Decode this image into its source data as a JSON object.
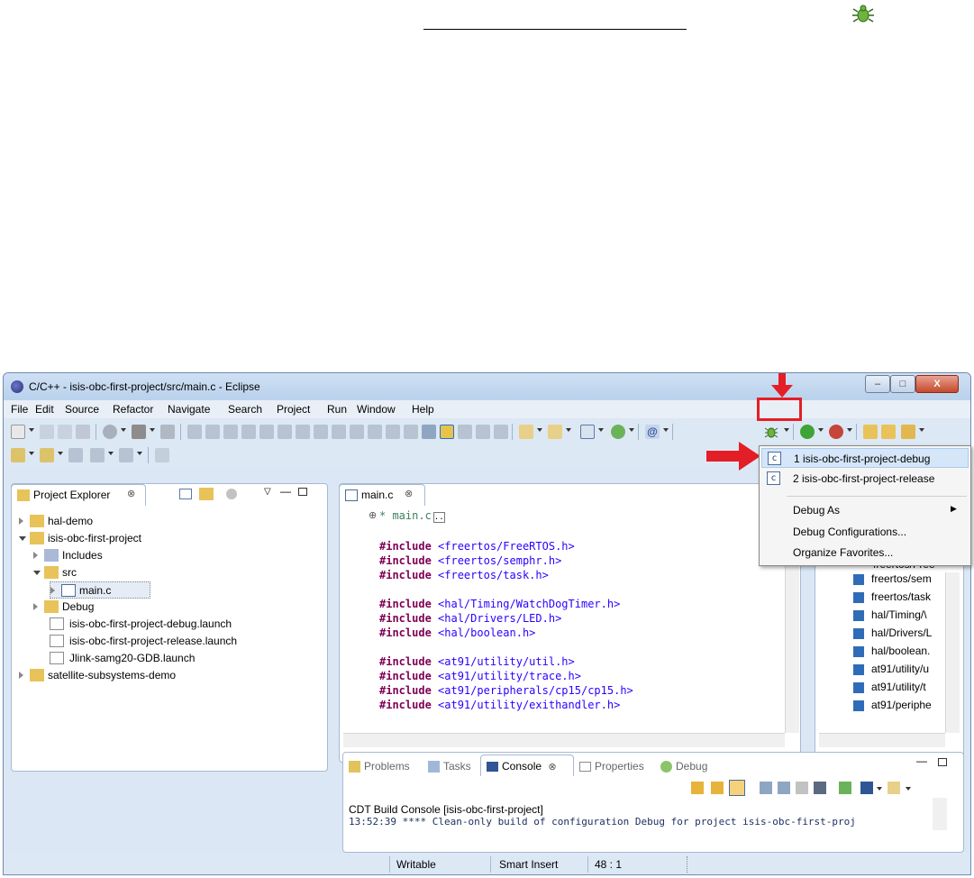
{
  "window": {
    "title": "C/C++ - isis-obc-first-project/src/main.c - Eclipse",
    "close_label": "X"
  },
  "menu": [
    "File",
    "Edit",
    "Source",
    "Refactor",
    "Navigate",
    "Search",
    "Project",
    "Run",
    "Window",
    "Help"
  ],
  "project_explorer": {
    "tab_label": "Project Explorer",
    "tree": [
      {
        "label": "hal-demo"
      },
      {
        "label": "isis-obc-first-project"
      },
      {
        "label": "Includes"
      },
      {
        "label": "src"
      },
      {
        "label": "main.c"
      },
      {
        "label": "Debug"
      },
      {
        "label": "isis-obc-first-project-debug.launch"
      },
      {
        "label": "isis-obc-first-project-release.launch"
      },
      {
        "label": "Jlink-samg20-GDB.launch"
      },
      {
        "label": "satellite-subsystems-demo"
      }
    ]
  },
  "editor": {
    "tab_label": "main.c",
    "collapsed_comment": "* main.c",
    "lines": [
      {
        "kw": "#include",
        "path": "<freertos/FreeRTOS.h>"
      },
      {
        "kw": "#include",
        "path": "<freertos/semphr.h>"
      },
      {
        "kw": "#include",
        "path": "<freertos/task.h>"
      },
      {
        "kw": "#include",
        "path": "<hal/Timing/WatchDogTimer.h>"
      },
      {
        "kw": "#include",
        "path": "<hal/Drivers/LED.h>"
      },
      {
        "kw": "#include",
        "path": "<hal/boolean.h>"
      },
      {
        "kw": "#include",
        "path": "<at91/utility/util.h>"
      },
      {
        "kw": "#include",
        "path": "<at91/utility/trace.h>"
      },
      {
        "kw": "#include",
        "path": "<at91/peripherals/cp15/cp15.h>"
      },
      {
        "kw": "#include",
        "path": "<at91/utility/exithandler.h>"
      }
    ]
  },
  "outline": {
    "items": [
      "freertos/sem",
      "freertos/task",
      "hal/Timing/\\",
      "hal/Drivers/L",
      "hal/boolean.",
      "at91/utility/u",
      "at91/utility/t",
      "at91/periphe"
    ],
    "partial_top": "freertos/Free"
  },
  "console": {
    "tabs": [
      "Problems",
      "Tasks",
      "Console",
      "Properties",
      "Debug"
    ],
    "header": "CDT Build Console [isis-obc-first-project]",
    "line": "13:52:39 **** Clean-only build of configuration Debug for project isis-obc-first-proj"
  },
  "statusbar": {
    "writable": "Writable",
    "insert_mode": "Smart Insert",
    "position": "48 : 1"
  },
  "debug_menu": {
    "items": [
      "1 isis-obc-first-project-debug",
      "2 isis-obc-first-project-release"
    ],
    "actions": [
      "Debug As",
      "Debug Configurations...",
      "Organize Favorites..."
    ]
  },
  "colors": {
    "highlight_red": "#e41e26",
    "keyword": "#7f0055",
    "string": "#2a00ff"
  }
}
